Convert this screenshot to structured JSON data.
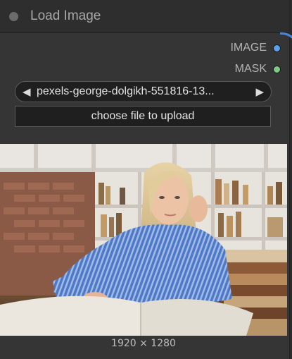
{
  "node": {
    "title": "Load Image",
    "outputs": [
      {
        "label": "IMAGE",
        "color": "#5aa2ee"
      },
      {
        "label": "MASK",
        "color": "#80c987"
      }
    ],
    "image_widget": {
      "value": "pexels-george-dolgikh-551816-13...",
      "prev_icon": "triangle-left-icon",
      "next_icon": "triangle-right-icon"
    },
    "upload_button_label": "choose file to upload",
    "preview": {
      "description": "girl-studying-at-desk-with-books",
      "dimensions_label": "1920 × 1280"
    }
  },
  "colors": {
    "node_bg": "#353535",
    "title_bg": "#2e2e2e",
    "wire": "#4a86d8"
  }
}
